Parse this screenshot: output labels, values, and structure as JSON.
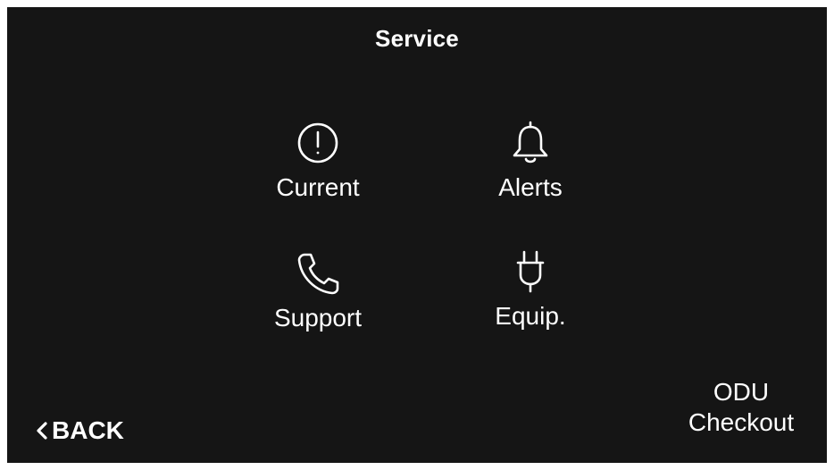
{
  "header": {
    "title": "Service"
  },
  "tiles": [
    {
      "label": "Current",
      "icon": "alert-circle-icon"
    },
    {
      "label": "Alerts",
      "icon": "bell-icon"
    },
    {
      "label": "Support",
      "icon": "phone-icon"
    },
    {
      "label": "Equip.",
      "icon": "plug-icon"
    }
  ],
  "footer": {
    "back_label": "BACK",
    "odu_line1": "ODU",
    "odu_line2": "Checkout"
  },
  "colors": {
    "background": "#151515",
    "foreground": "#ffffff"
  }
}
